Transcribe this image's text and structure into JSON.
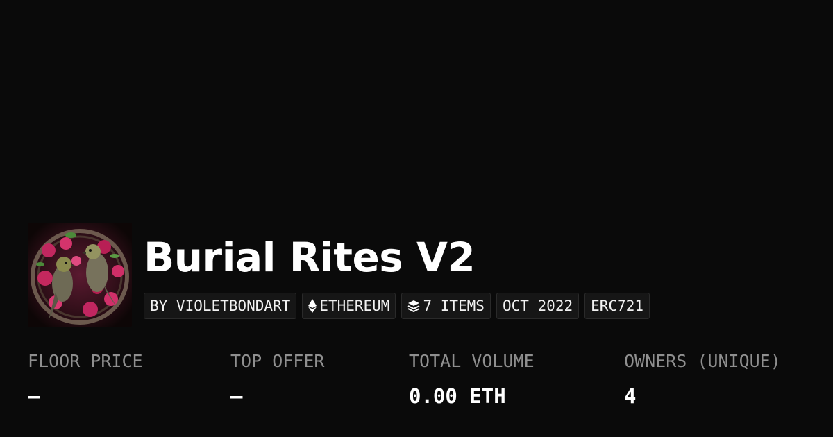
{
  "collection": {
    "title": "Burial Rites V2",
    "avatar_icon": "bird-artwork-icon"
  },
  "tags": {
    "creator": "BY VIOLETBONDART",
    "chain": "ETHEREUM",
    "chain_icon": "ethereum-icon",
    "items": "7 ITEMS",
    "items_icon": "layers-icon",
    "date": "OCT 2022",
    "standard": "ERC721"
  },
  "stats": {
    "floor_price": {
      "label": "FLOOR PRICE",
      "value": "–"
    },
    "top_offer": {
      "label": "TOP OFFER",
      "value": "–"
    },
    "total_volume": {
      "label": "TOTAL VOLUME",
      "value": "0.00 ETH"
    },
    "owners": {
      "label": "OWNERS (UNIQUE)",
      "value": "4"
    }
  },
  "colors": {
    "background": "#0a0a0a",
    "tag_background": "#161616",
    "label_gray": "#8f8f8f"
  }
}
